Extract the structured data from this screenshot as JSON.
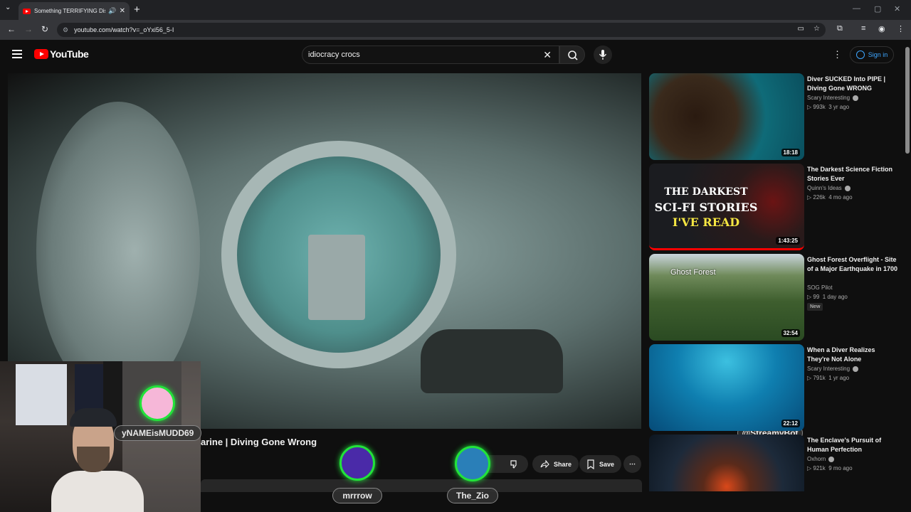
{
  "browser": {
    "tab_title": "Something TERRIFYING Dis",
    "new_tab": "+",
    "url": "youtube.com/watch?v=_oYxi56_5-I"
  },
  "youtube": {
    "logo_text": "YouTube",
    "search_value": "idiocracy crocs",
    "signin_label": "Sign in"
  },
  "video": {
    "title_partial": "arine | Diving Gone Wrong",
    "share_label": "Share",
    "save_label": "Save",
    "like_partial": "k"
  },
  "overlays": [
    {
      "name": "yNAMEisMUDD69",
      "avatar_color": "#f6b7d8"
    },
    {
      "name": "mrrrow",
      "avatar_color": "#4a2aa8"
    },
    {
      "name": "The_Zio",
      "avatar_color": "#2a7fb8"
    },
    {
      "name": "@StreamyBot",
      "avatar_color": "#2e4fc9"
    }
  ],
  "recommendations": [
    {
      "title": "Diver SUCKED Into PIPE | Diving Gone WRONG",
      "channel": "Scary Interesting",
      "verified": true,
      "views": "993k",
      "age": "3 yr ago",
      "duration": "18:18",
      "badge": ""
    },
    {
      "title": "The Darkest Science Fiction Stories Ever",
      "channel": "Quinn's Ideas",
      "verified": true,
      "views": "226k",
      "age": "4 mo ago",
      "duration": "1:43:25",
      "badge": "",
      "thumb_text": [
        "THE DARKEST",
        "SCI-FI STORIES",
        "I'VE READ"
      ]
    },
    {
      "title": "Ghost Forest Overflight - Site of a Major Earthquake in 1700",
      "channel": "SOG Pilot",
      "verified": false,
      "views": "99",
      "age": "1 day ago",
      "duration": "32:54",
      "badge": "New",
      "thumb_text": [
        "Ghost Forest"
      ]
    },
    {
      "title": "When a Diver Realizes They're Not Alone",
      "channel": "Scary Interesting",
      "verified": true,
      "views": "791k",
      "age": "1 yr ago",
      "duration": "22:12",
      "badge": ""
    },
    {
      "title": "The Enclave's Pursuit of Human Perfection",
      "channel": "Oxhorn",
      "verified": true,
      "views": "921k",
      "age": "9 mo ago",
      "duration": "",
      "badge": ""
    }
  ]
}
